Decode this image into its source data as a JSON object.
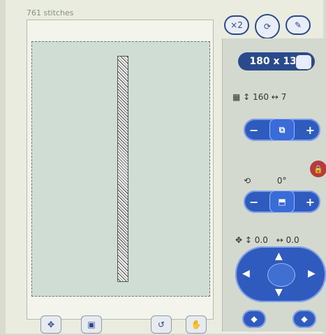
{
  "status": {
    "stitches": "761 stitches"
  },
  "top_buttons": [
    {
      "name": "copies-button",
      "icon": "x2-copies-icon",
      "label": "×2"
    },
    {
      "name": "rotate-view-button",
      "icon": "rotate-icon",
      "label": ""
    },
    {
      "name": "edit-button",
      "icon": "pen-icon",
      "label": ""
    }
  ],
  "hoop": {
    "size_label": "180 x 130"
  },
  "dimensions": {
    "height": "160",
    "width": "7",
    "height_glyph": "↕",
    "width_glyph": "↔"
  },
  "size_controls": {
    "minus": "−",
    "center_icon": "resize-icon",
    "plus": "+"
  },
  "rotation": {
    "angle": "0°",
    "minus": "−",
    "plus": "+",
    "center_icon": "rotate-edit-icon"
  },
  "lock": {
    "icon": "lock-icon"
  },
  "position": {
    "y": "0.0",
    "x": "0.0",
    "y_glyph": "↕",
    "x_glyph": "↔"
  },
  "dpad": {
    "up": "▲",
    "down": "▼",
    "left": "◀",
    "right": "▶"
  },
  "extra_buttons": [
    {
      "name": "left-extra-button",
      "icon": "diamond-left-icon",
      "glyph": "◆"
    },
    {
      "name": "right-extra-button",
      "icon": "diamond-right-icon",
      "glyph": "◆"
    }
  ],
  "bottom_bar": [
    {
      "name": "move-tool",
      "icon": "move-icon",
      "glyph": "✥"
    },
    {
      "name": "hoop-tool",
      "icon": "hoop-icon",
      "glyph": "▣"
    },
    {
      "name": "undo-tool",
      "icon": "undo-icon",
      "glyph": "↺"
    },
    {
      "name": "hand-tool",
      "icon": "hand-icon",
      "glyph": "✋"
    }
  ]
}
